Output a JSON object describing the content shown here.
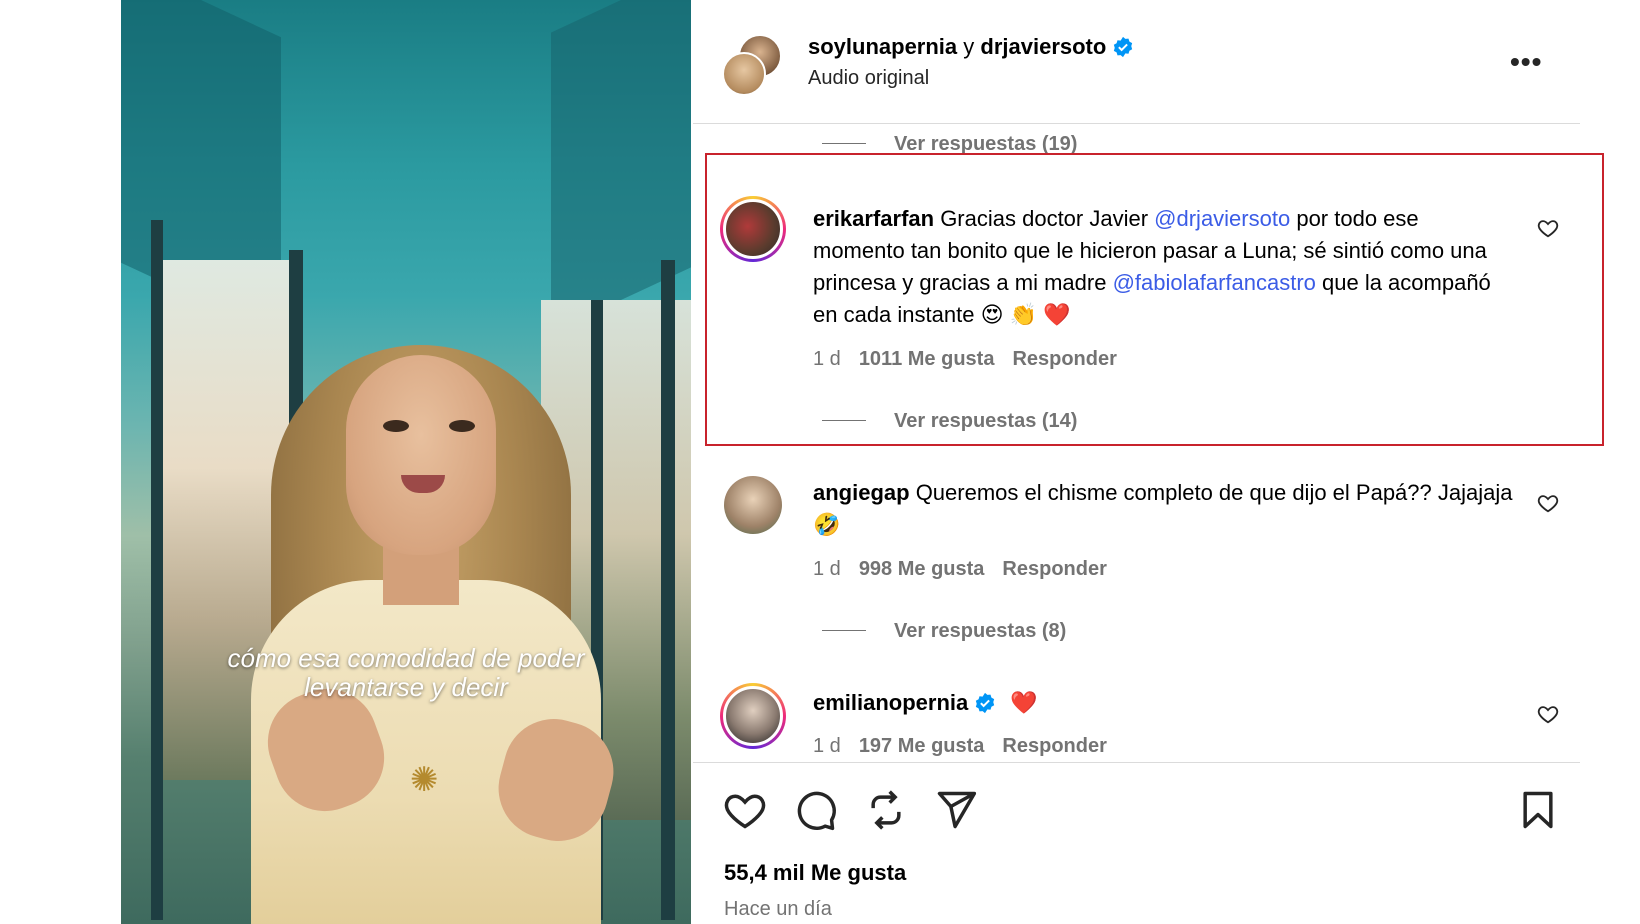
{
  "video": {
    "caption_line1": "cómo esa comodidad de poder",
    "caption_line2": "levantarse y decir"
  },
  "post_header": {
    "user1": "soylunapernia",
    "connector": " y ",
    "user2": "drjaviersoto",
    "audio": "Audio original",
    "more_icon": "•••"
  },
  "comments": [
    {
      "prev_replies": "Ver respuestas (19)"
    },
    {
      "username": "erikarfarfan",
      "text_part1": " Gracias doctor Javier ",
      "mention1": "@drjaviersoto",
      "text_part2": " por todo ese momento tan bonito que le hicieron pasar a Luna; sé sintió como una princesa y gracias a mi madre ",
      "mention2": "@fabiolafarfancastro",
      "text_part3": " que la acompañó en cada instante 😍 👏 ❤️",
      "time": "1 d",
      "likes": "1011 Me gusta",
      "reply": "Responder",
      "replies": "Ver respuestas (14)"
    },
    {
      "username": "angiegap",
      "text": " Queremos el chisme completo de que dijo el Papá?? Jajajaja 🤣",
      "time": "1 d",
      "likes": "998 Me gusta",
      "reply": "Responder",
      "replies": "Ver respuestas (8)"
    },
    {
      "username": "emilianopernia",
      "text": "❤️",
      "time": "1 d",
      "likes": "197 Me gusta",
      "reply": "Responder"
    }
  ],
  "footer": {
    "likes": "55,4 mil Me gusta",
    "time": "Hace un día"
  },
  "colors": {
    "mention": "#3b5ce6",
    "verified": "#0095f6",
    "highlight": "#c8232c",
    "secondary_text": "#737373"
  },
  "icons": [
    "heart-icon",
    "comment-icon",
    "repost-icon",
    "share-icon",
    "bookmark-icon",
    "verified-icon",
    "more-icon"
  ]
}
